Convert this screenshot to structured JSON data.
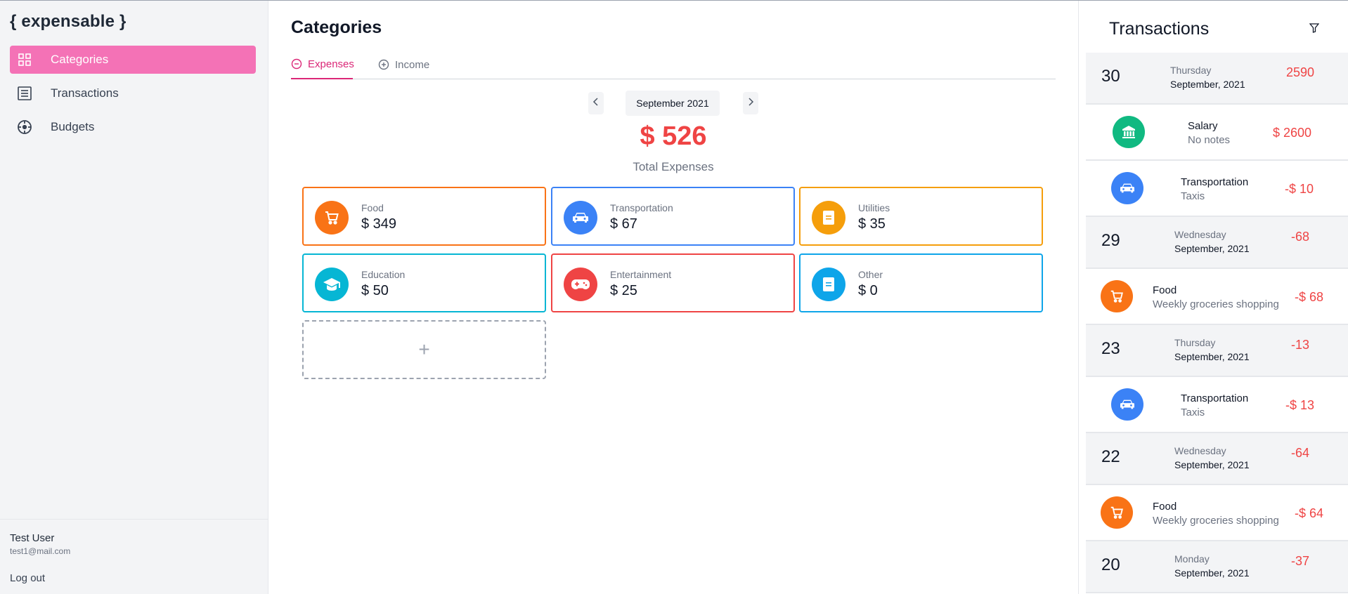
{
  "app": {
    "logo": "{ expensable }"
  },
  "sidebar": {
    "items": [
      {
        "label": "Categories",
        "icon": "grid-icon",
        "active": true
      },
      {
        "label": "Transactions",
        "icon": "list-icon",
        "active": false
      },
      {
        "label": "Budgets",
        "icon": "target-icon",
        "active": false
      }
    ],
    "user": {
      "name": "Test User",
      "email": "test1@mail.com",
      "logout_label": "Log out"
    }
  },
  "main": {
    "title": "Categories",
    "tabs": [
      {
        "label": "Expenses",
        "icon": "minus-circle-icon",
        "active": true
      },
      {
        "label": "Income",
        "icon": "plus-circle-icon",
        "active": false
      }
    ],
    "month": "September 2021",
    "total_amount": "$ 526",
    "total_label": "Total Expenses",
    "categories": [
      {
        "name": "Food",
        "amount": "$ 349",
        "icon": "cart-icon",
        "color": "#f97316"
      },
      {
        "name": "Transportation",
        "amount": "$ 67",
        "icon": "car-icon",
        "color": "#3b82f6"
      },
      {
        "name": "Utilities",
        "amount": "$ 35",
        "icon": "bill-icon",
        "color": "#f59e0b"
      },
      {
        "name": "Education",
        "amount": "$ 50",
        "icon": "graduation-cap-icon",
        "color": "#06b6d4"
      },
      {
        "name": "Entertainment",
        "amount": "$ 25",
        "icon": "gamepad-icon",
        "color": "#ef4444"
      },
      {
        "name": "Other",
        "amount": "$ 0",
        "icon": "bill-icon",
        "color": "#0ea5e9"
      }
    ],
    "add_label": "+"
  },
  "transactions": {
    "title": "Transactions",
    "groups": [
      {
        "day": "30",
        "weekday": "Thursday",
        "month_year": "September, 2021",
        "total": "2590",
        "items": [
          {
            "name": "Salary",
            "note": "No notes",
            "amount": "$ 2600",
            "icon": "bank-icon",
            "color": "#10b981"
          },
          {
            "name": "Transportation",
            "note": "Taxis",
            "amount": "-$ 10",
            "icon": "car-icon",
            "color": "#3b82f6"
          }
        ]
      },
      {
        "day": "29",
        "weekday": "Wednesday",
        "month_year": "September, 2021",
        "total": "-68",
        "items": [
          {
            "name": "Food",
            "note": "Weekly groceries shopping",
            "amount": "-$ 68",
            "icon": "cart-icon",
            "color": "#f97316"
          }
        ]
      },
      {
        "day": "23",
        "weekday": "Thursday",
        "month_year": "September, 2021",
        "total": "-13",
        "items": [
          {
            "name": "Transportation",
            "note": "Taxis",
            "amount": "-$ 13",
            "icon": "car-icon",
            "color": "#3b82f6"
          }
        ]
      },
      {
        "day": "22",
        "weekday": "Wednesday",
        "month_year": "September, 2021",
        "total": "-64",
        "items": [
          {
            "name": "Food",
            "note": "Weekly groceries shopping",
            "amount": "-$ 64",
            "icon": "cart-icon",
            "color": "#f97316"
          }
        ]
      },
      {
        "day": "20",
        "weekday": "Monday",
        "month_year": "September, 2021",
        "total": "-37",
        "items": []
      }
    ]
  },
  "colors": {
    "accent": "#f472b6",
    "accent_text": "#db2777",
    "negative": "#ef4444"
  }
}
